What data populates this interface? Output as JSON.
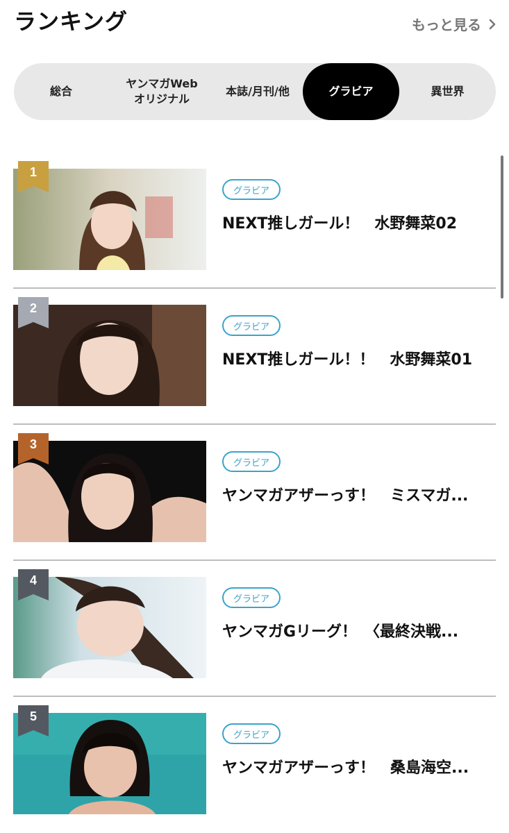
{
  "header": {
    "title": "ランキング",
    "more_label": "もっと見る",
    "more_icon": "chevron-right-icon"
  },
  "tabs": [
    {
      "label": "総合",
      "active": false
    },
    {
      "label": "ヤンマガWeb\nオリジナル",
      "active": false
    },
    {
      "label": "本誌/月刊/他",
      "active": false
    },
    {
      "label": "グラビア",
      "active": true
    },
    {
      "label": "異世界",
      "active": false
    }
  ],
  "ranking": [
    {
      "rank": "1",
      "tag": "グラビア",
      "title": "NEXT推しガール！　水野舞菜02",
      "badge_color": "#c9a040"
    },
    {
      "rank": "2",
      "tag": "グラビア",
      "title": "NEXT推しガール！！　水野舞菜01",
      "badge_color": "#a4a9b2"
    },
    {
      "rank": "3",
      "tag": "グラビア",
      "title": "ヤンマガアザーっす！　ミスマガ...",
      "badge_color": "#b4642a"
    },
    {
      "rank": "4",
      "tag": "グラビア",
      "title": "ヤンマガGリーグ！　〈最終決戦...",
      "badge_color": "#545961"
    },
    {
      "rank": "5",
      "tag": "グラビア",
      "title": "ヤンマガアザーっす！　桑島海空...",
      "badge_color": "#545961"
    }
  ],
  "colors": {
    "accent_tag": "#3aa3c9",
    "tab_bg": "#e8e8e8",
    "tab_active_bg": "#000000"
  }
}
